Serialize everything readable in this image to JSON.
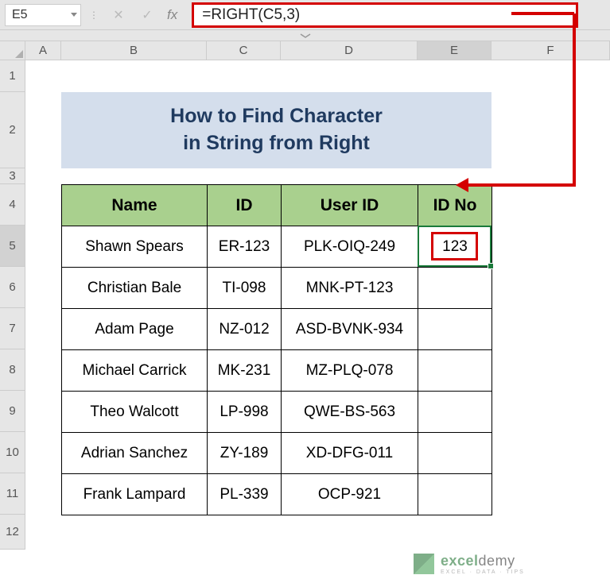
{
  "namebox": {
    "value": "E5"
  },
  "formula_bar": {
    "formula": "=RIGHT(C5,3)"
  },
  "columns": [
    "A",
    "B",
    "C",
    "D",
    "E",
    "F"
  ],
  "rows": [
    "1",
    "2",
    "3",
    "4",
    "5",
    "6",
    "7",
    "8",
    "9",
    "10",
    "11",
    "12"
  ],
  "title": {
    "line1": "How to Find Character",
    "line2": "in String from Right"
  },
  "headers": {
    "name": "Name",
    "id": "ID",
    "userid": "User ID",
    "idno": "ID No"
  },
  "table": [
    {
      "name": "Shawn Spears",
      "id": "ER-123",
      "userid": "PLK-OIQ-249",
      "idno": "123"
    },
    {
      "name": "Christian Bale",
      "id": "TI-098",
      "userid": "MNK-PT-123",
      "idno": ""
    },
    {
      "name": "Adam Page",
      "id": "NZ-012",
      "userid": "ASD-BVNK-934",
      "idno": ""
    },
    {
      "name": "Michael Carrick",
      "id": "MK-231",
      "userid": "MZ-PLQ-078",
      "idno": ""
    },
    {
      "name": "Theo Walcott",
      "id": "LP-998",
      "userid": "QWE-BS-563",
      "idno": ""
    },
    {
      "name": "Adrian Sanchez",
      "id": "ZY-189",
      "userid": "XD-DFG-011",
      "idno": ""
    },
    {
      "name": "Frank Lampard",
      "id": "PL-339",
      "userid": "OCP-921",
      "idno": ""
    }
  ],
  "watermark": {
    "brand_part1": "excel",
    "brand_part2": "demy",
    "tagline": "EXCEL · DATA · TIPS"
  },
  "icons": {
    "cancel": "✕",
    "confirm": "✓",
    "fx": "fx",
    "divider": "⋮"
  }
}
